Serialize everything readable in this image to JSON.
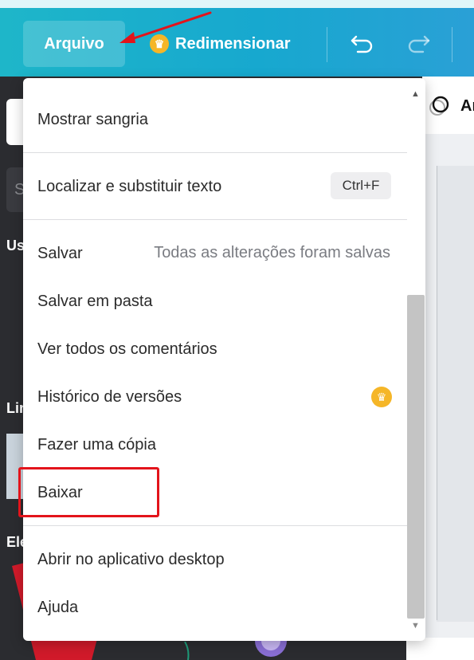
{
  "topbar": {
    "file_label": "Arquivo",
    "resize_label": "Redimensionar",
    "undo_icon": "undo-icon",
    "redo_icon": "redo-icon"
  },
  "sidebar": {
    "search_prefix": "S",
    "section1": "Us",
    "section2": "Lin",
    "section3": "Ele"
  },
  "canvas": {
    "label": "Ar"
  },
  "menu": {
    "items": [
      {
        "label": "Mostrar sangria"
      },
      {
        "label": "Localizar e substituir texto",
        "shortcut": "Ctrl+F"
      },
      {
        "label": "Salvar",
        "hint": "Todas as alterações foram salvas"
      },
      {
        "label": "Salvar em pasta"
      },
      {
        "label": "Ver todos os comentários"
      },
      {
        "label": "Histórico de versões",
        "badge": "crown-icon"
      },
      {
        "label": "Fazer uma cópia"
      },
      {
        "label": "Baixar"
      },
      {
        "label": "Abrir no aplicativo desktop"
      },
      {
        "label": "Ajuda"
      }
    ]
  },
  "colors": {
    "topbar": "#17a8cf",
    "highlight": "#e3141b",
    "crown": "#f5b628"
  }
}
